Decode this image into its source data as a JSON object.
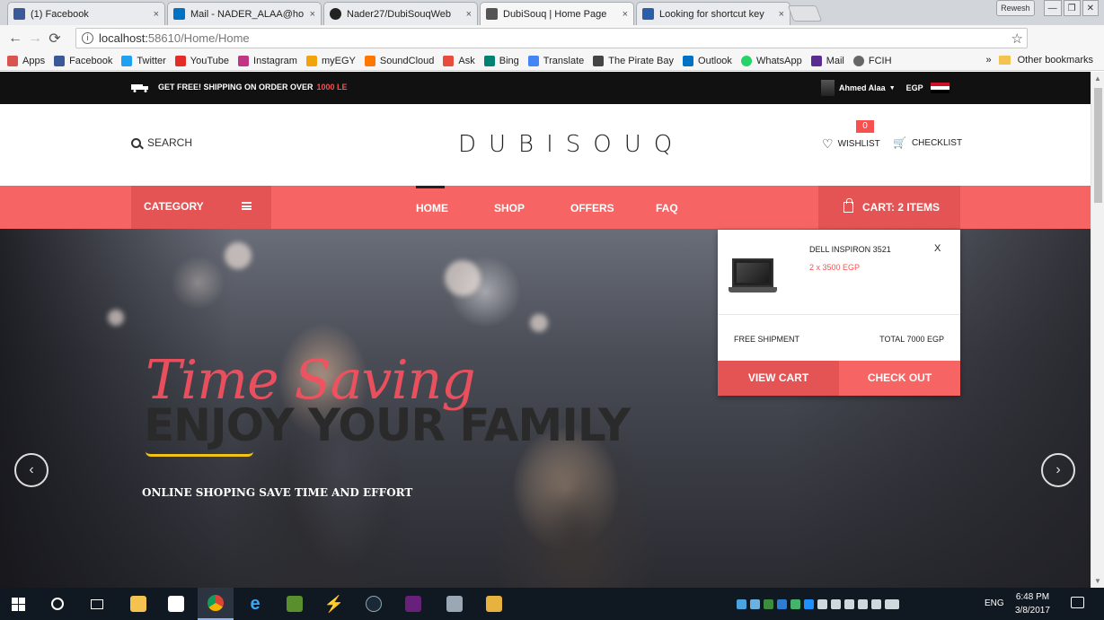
{
  "browser": {
    "tabs": [
      {
        "label": "(1) Facebook",
        "color": "#3b5998"
      },
      {
        "label": "Mail - NADER_ALAA@ho",
        "color": "#0072c6"
      },
      {
        "label": "Nader27/DubiSouqWeb",
        "color": "#222222"
      },
      {
        "label": "DubiSouq | Home Page",
        "color": "#555555"
      },
      {
        "label": "Looking for shortcut key",
        "color": "#2a5ea8"
      }
    ],
    "tab_close": "×",
    "window_refresh": "Rewesh",
    "url_host": "localhost:",
    "url_rest": "58610/Home/Home",
    "bookmarks": [
      {
        "label": "Apps",
        "color": "#d9534f"
      },
      {
        "label": "Facebook",
        "color": "#3b5998"
      },
      {
        "label": "Twitter",
        "color": "#1da1f2"
      },
      {
        "label": "YouTube",
        "color": "#e52d27"
      },
      {
        "label": "Instagram",
        "color": "#c13584"
      },
      {
        "label": "myEGY",
        "color": "#f0a30a"
      },
      {
        "label": "SoundCloud",
        "color": "#ff7700"
      },
      {
        "label": "Ask",
        "color": "#e74c3c"
      },
      {
        "label": "Bing",
        "color": "#008373"
      },
      {
        "label": "Translate",
        "color": "#4285f4"
      },
      {
        "label": "The Pirate Bay",
        "color": "#444444"
      },
      {
        "label": "Outlook",
        "color": "#0072c6"
      },
      {
        "label": "WhatsApp",
        "color": "#25d366"
      },
      {
        "label": "Mail",
        "color": "#5c2d91"
      },
      {
        "label": "FCIH",
        "color": "#666666"
      }
    ],
    "bookmarks_more": "»",
    "other_bookmarks": "Other bookmarks"
  },
  "site": {
    "shipping_text": "GET FREE! SHIPPING ON ORDER OVER",
    "shipping_amount": "1000 LE",
    "user_name": "Ahmed Alaa",
    "currency": "EGP",
    "search_label": "SEARCH",
    "logo": "DUBISOUQ",
    "wishlist_label": "WISHLIST",
    "wishlist_count": "0",
    "checklist_label": "CHECKLIST",
    "category_label": "CATEGORY",
    "nav": {
      "home": "HOME",
      "shop": "SHOP",
      "offers": "OFFERS",
      "faq": "FAQ"
    },
    "cart_label": "CART: 2 ITEMS",
    "accent": "#f76464"
  },
  "cart": {
    "product_name": "DELL INSPIRON 3521",
    "product_qty": "2 x 3500 EGP",
    "remove": "X",
    "shipment": "FREE SHIPMENT",
    "total": "TOTAL 7000 EGP",
    "view_cart": "VIEW CART",
    "check_out": "CHECK OUT"
  },
  "hero": {
    "script_title": "Time Saving",
    "headline": "ENJOY YOUR FAMILY",
    "subtitle": "ONLINE SHOPING SAVE TIME AND EFFORT",
    "prev": "‹",
    "next": "›"
  },
  "taskbar": {
    "language": "ENG",
    "time": "6:48 PM",
    "date": "3/8/2017"
  }
}
